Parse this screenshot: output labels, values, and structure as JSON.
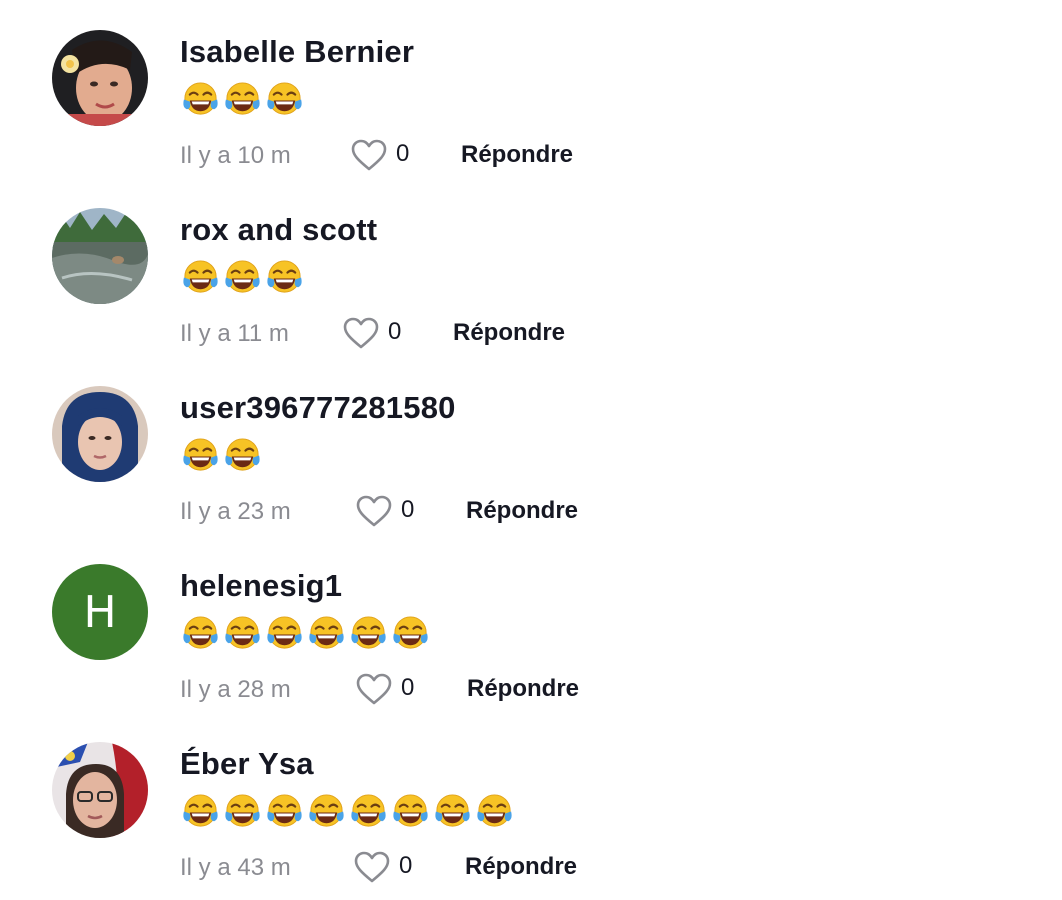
{
  "comments": [
    {
      "username": "Isabelle Bernier",
      "emoji_count": 3,
      "time": "Il y a 10 m",
      "likes": "0",
      "reply_label": "Répondre",
      "avatar": {
        "type": "photo",
        "bg": "#2a2a2a",
        "accent": "#e8b9a0"
      }
    },
    {
      "username": "rox and scott",
      "emoji_count": 3,
      "time": "Il y a 11 m",
      "likes": "0",
      "reply_label": "Répondre",
      "avatar": {
        "type": "photo",
        "bg": "#4e6a55",
        "accent": "#8fa2a8"
      }
    },
    {
      "username": "user396777281580",
      "emoji_count": 2,
      "time": "Il y a 23 m",
      "likes": "0",
      "reply_label": "Répondre",
      "avatar": {
        "type": "photo",
        "bg": "#243a66",
        "accent": "#e7c4b0"
      }
    },
    {
      "username": "helenesig1",
      "emoji_count": 6,
      "time": "Il y a 28 m",
      "likes": "0",
      "reply_label": "Répondre",
      "avatar": {
        "type": "letter",
        "letter": "H",
        "bg": "#3a7a2b"
      }
    },
    {
      "username": "Éber Ysa",
      "emoji_count": 8,
      "time": "Il y a 43 m",
      "likes": "0",
      "reply_label": "Répondre",
      "avatar": {
        "type": "photo",
        "bg": "#b5232a",
        "accent": "#e0b39e"
      }
    }
  ],
  "emoji_name": "face-with-tears-of-joy",
  "colors": {
    "username": "#161823",
    "time": "#8a8b91",
    "like_icon": "#8a8b91",
    "emoji_face": "#f7c325",
    "emoji_tears": "#4aa3e8"
  }
}
